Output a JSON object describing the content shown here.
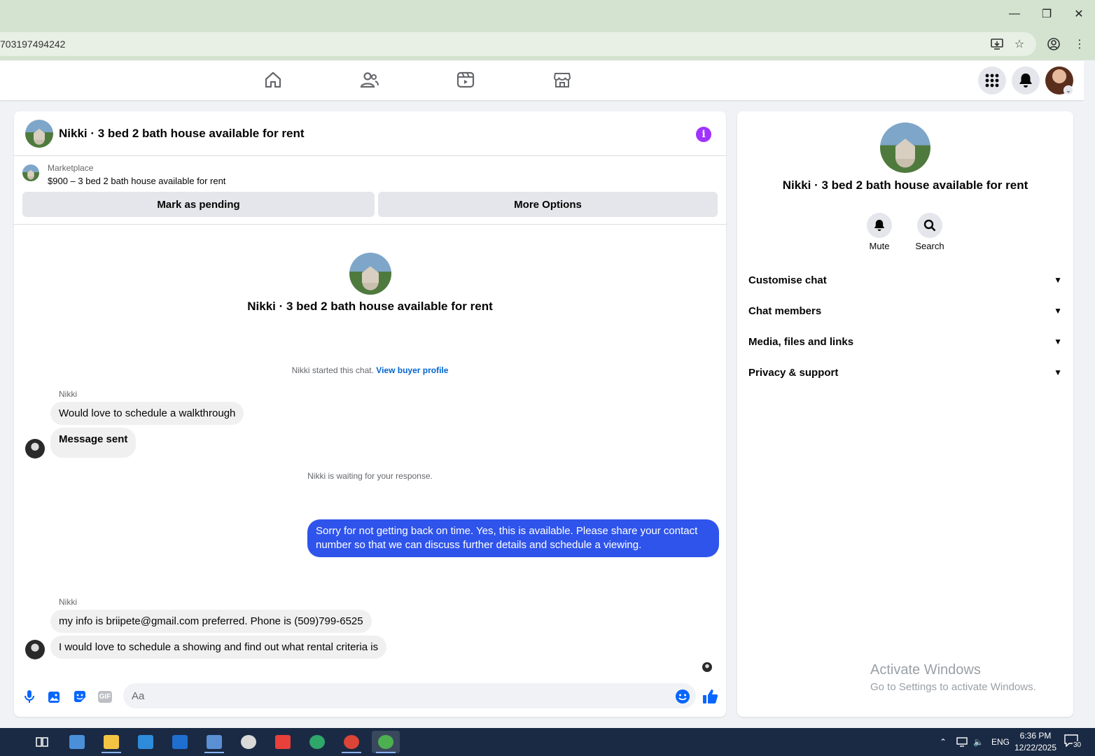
{
  "browser": {
    "url": "703197494242",
    "win_controls": {
      "minimize": "—",
      "restore": "❐",
      "close": "✕"
    }
  },
  "fb_nav": {
    "tabs": [
      "home-icon",
      "friends-icon",
      "video-icon",
      "marketplace-icon"
    ],
    "right": [
      "menu-grid-icon",
      "notifications-icon",
      "account-avatar"
    ]
  },
  "chat": {
    "title": "Nikki · 3 bed 2 bath house available for rent",
    "marketplace_label": "Marketplace",
    "listing": "$900 – 3 bed 2 bath house available for rent",
    "mark_pending": "Mark as pending",
    "more_options": "More Options",
    "center_title": "Nikki · 3 bed 2 bath house available for rent",
    "started_text": "Nikki started this chat.",
    "view_profile": "View buyer profile",
    "sender1": "Nikki",
    "msg1": "Would love to schedule a walkthrough",
    "msg2": "Message sent",
    "waiting": "Nikki is waiting for your response.",
    "outgoing": "Sorry for not getting back on time. Yes, this is available. Please share your contact number so that we can discuss further details and schedule a viewing.",
    "sender2": "Nikki",
    "msg3": "my info is briipete@gmail.com preferred. Phone is (509)799-6525",
    "msg4": "I would love to schedule a showing and find out what rental criteria is",
    "input_placeholder": "Aa",
    "gif_label": "GIF"
  },
  "info_panel": {
    "title": "Nikki · 3 bed 2 bath house available for rent",
    "mute": "Mute",
    "search": "Search",
    "sections": [
      "Customise chat",
      "Chat members",
      "Media, files and links",
      "Privacy & support"
    ]
  },
  "watermark": {
    "line1": "Activate Windows",
    "line2": "Go to Settings to activate Windows."
  },
  "taskbar": {
    "lang": "ENG",
    "time": "6:36 PM",
    "date": "12/22/2025",
    "notifications": "30"
  },
  "colors": {
    "accent": "#0866ff",
    "outgoing_bubble": "#2f54eb",
    "info_icon": "#a033ff",
    "chrome_frame": "#d3e3d0"
  }
}
